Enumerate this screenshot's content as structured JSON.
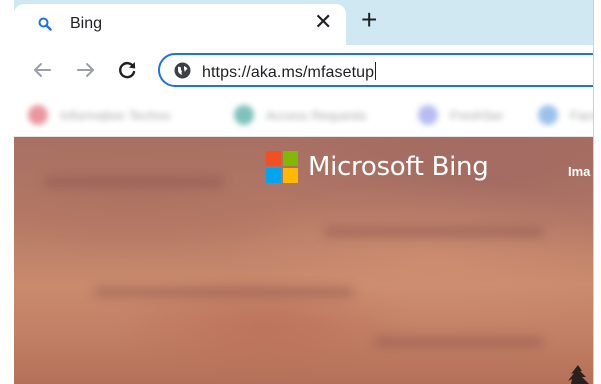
{
  "browser": {
    "tab": {
      "title": "Bing",
      "favicon": "search-icon",
      "close_glyph": "✕"
    },
    "new_tab_glyph": "+",
    "toolbar": {
      "back_icon": "arrow-left-icon",
      "forward_icon": "arrow-right-icon",
      "reload_icon": "reload-icon",
      "site_info_icon": "globe-icon",
      "url": "https://aka.ms/mfasetup"
    },
    "bookmarks": [
      {
        "label": "Information Techno",
        "color": "#d9434f"
      },
      {
        "label": "Access Requests",
        "color": "#1a8f83"
      },
      {
        "label": "FreshSer",
        "color": "#7d86e8"
      },
      {
        "label": "Face",
        "color": "#4a90d9"
      }
    ]
  },
  "page": {
    "brand_name": "Microsoft Bing",
    "logo_colors": [
      "#f25022",
      "#7fba00",
      "#00a4ef",
      "#ffb900"
    ],
    "nav_images_label": "Ima"
  },
  "colors": {
    "tabstrip": "#cfe8f1",
    "accent": "#1a73e8"
  }
}
